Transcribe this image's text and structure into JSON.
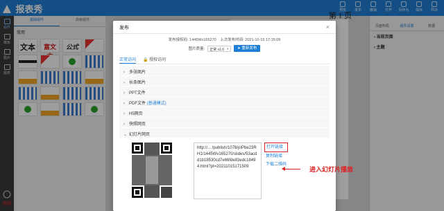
{
  "app": {
    "name": "报表秀"
  },
  "topbar": {
    "tools": [
      "预览",
      "发布",
      "撤销",
      "打开",
      "另存为",
      "保存",
      "导出"
    ]
  },
  "leftnav": {
    "items": [
      "组件",
      "模板",
      "图片",
      "报表"
    ]
  },
  "components": {
    "tabs": [
      "基础组件",
      "高级组件"
    ],
    "section": "常用",
    "big_labels": [
      "文本",
      "富文本",
      "公式"
    ]
  },
  "canvas": {
    "page_number": "第 1 页"
  },
  "rightpanel": {
    "tabs": [
      "页面布局",
      "组件设置",
      "数据"
    ],
    "sections": [
      "当前页面",
      "主题"
    ]
  },
  "modal": {
    "title": "发布",
    "close": "×",
    "meta": {
      "code": "发布授权码: 1445Wv165270",
      "time": "上次发布时间: 2021-10-15 17:15:09"
    },
    "quality_label": "图片质量:",
    "quality_value": "正常 x1.0",
    "republish": "重新发布",
    "tabs": [
      "正常访问",
      "授权访问"
    ],
    "items": [
      {
        "label": "多张图片",
        "extra": ""
      },
      {
        "label": "长条图片",
        "extra": ""
      },
      {
        "label": "PPT文件",
        "extra": ""
      },
      {
        "label": "PDF文件",
        "extra": "(普通模式)"
      },
      {
        "label": "H5网页",
        "extra": ""
      },
      {
        "label": "快照网页",
        "extra": ""
      },
      {
        "label": "幻灯片网页",
        "extra": ""
      }
    ],
    "url": "http://... /publish/1078/pIPbe23RH1/1445Wv165270/slides/53acdd1b18530cd7e66fde83edc18494.html?pt=20211015171509",
    "links": {
      "open": "打开链接",
      "copy": "复制链接",
      "qr": "下载二维码"
    }
  },
  "annotation": {
    "text": "进入幻灯片播放",
    "color": "#e02020"
  },
  "help": {
    "label": "客服"
  },
  "colors": {
    "brand": "#1f7fd6",
    "annotation": "#e02020"
  }
}
